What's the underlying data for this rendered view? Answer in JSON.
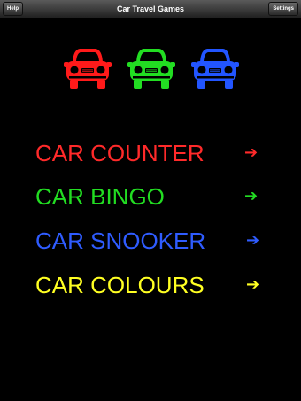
{
  "navbar": {
    "title": "Car Travel Games",
    "help_label": "Help",
    "settings_label": "Settings"
  },
  "cars": [
    {
      "color": "#ff1a1a",
      "icon": "car-icon"
    },
    {
      "color": "#22dd22",
      "icon": "car-icon"
    },
    {
      "color": "#2255ff",
      "icon": "car-icon"
    }
  ],
  "menu": {
    "items": [
      {
        "label": "CAR COUNTER",
        "arrow": "➔",
        "color": "#ff2a2a"
      },
      {
        "label": "CAR BINGO",
        "arrow": "➔",
        "color": "#22dd22"
      },
      {
        "label": "CAR SNOOKER",
        "arrow": "➔",
        "color": "#2f5cff"
      },
      {
        "label": "CAR COLOURS",
        "arrow": "➔",
        "color": "#ffff22"
      }
    ]
  }
}
